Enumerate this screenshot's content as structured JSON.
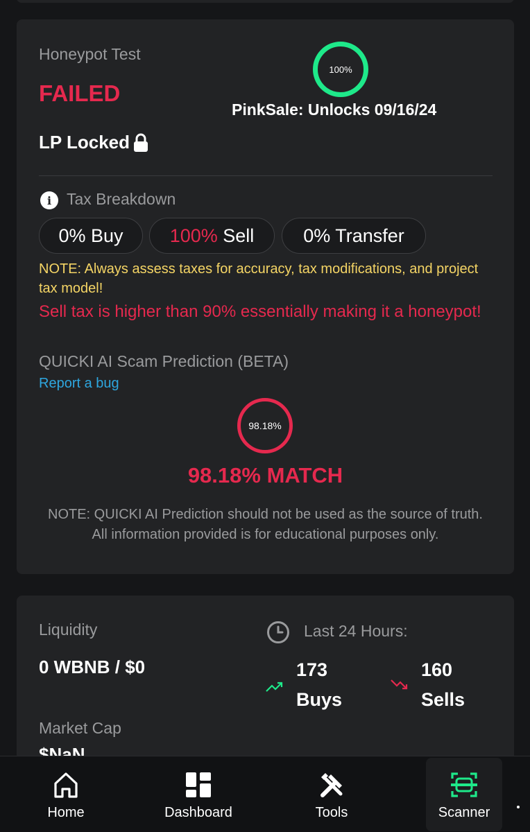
{
  "security": {
    "honeypot_label": "Honeypot Test",
    "honeypot_status": "FAILED",
    "lp_locked": "LP Locked",
    "lock_percent": "100%",
    "unlock_info": "PinkSale: Unlocks 09/16/24"
  },
  "tax": {
    "title": "Tax Breakdown",
    "buy_value": "0%",
    "buy_label": " Buy",
    "sell_value": "100%",
    "sell_label": " Sell",
    "transfer_value": "0%",
    "transfer_label": " Transfer",
    "note": "NOTE: Always assess taxes for accuracy, tax modifications, and project tax model!",
    "warning": "Sell tax is higher than 90% essentially making it a honeypot!"
  },
  "ai": {
    "title": "QUICKI AI Scam Prediction (BETA)",
    "report_link": "Report a bug",
    "ring_value": "98.18%",
    "match_text": "98.18% MATCH",
    "disclaimer": "NOTE: QUICKI AI Prediction should not be used as the source of truth. All information provided is for educational purposes only."
  },
  "market": {
    "liquidity_label": "Liquidity",
    "liquidity_value": "0 WBNB / $0",
    "last24_label": "Last 24 Hours:",
    "buys_count": "173",
    "buys_label": "Buys",
    "sells_count": "160",
    "sells_label": "Sells",
    "mcap_label": "Market Cap",
    "mcap_value": "$NaN"
  },
  "nav": {
    "home": "Home",
    "dashboard": "Dashboard",
    "tools": "Tools",
    "scanner": "Scanner"
  },
  "colors": {
    "accent_green": "#1ee98a",
    "danger_red": "#e5294e",
    "note_yellow": "#f5d565",
    "link_blue": "#2ea7e0"
  }
}
